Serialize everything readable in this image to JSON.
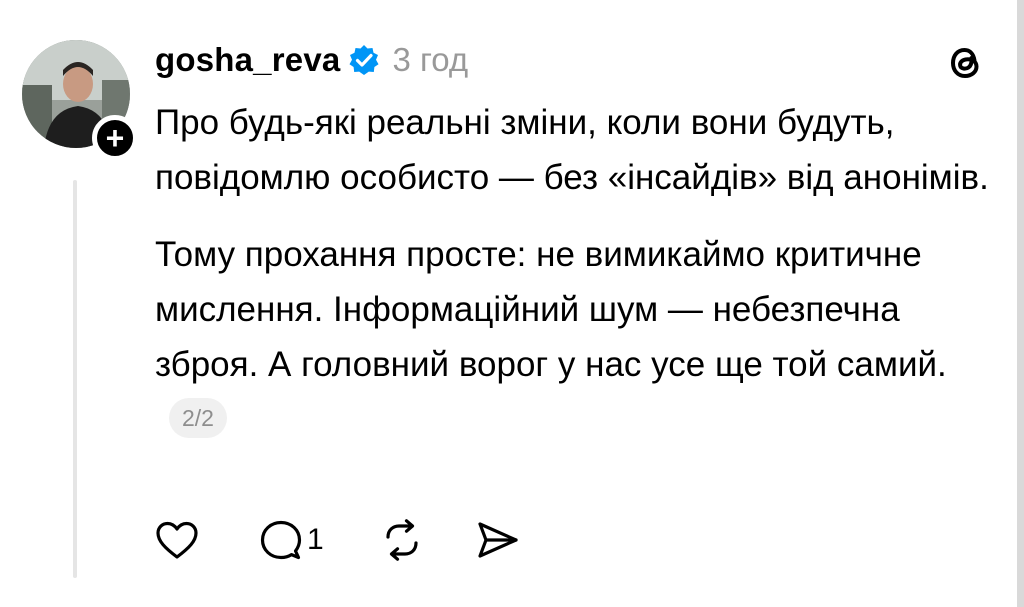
{
  "post": {
    "username": "gosha_reva",
    "time": "3 год",
    "paragraphs": [
      "Про будь-які реальні зміни, коли вони будуть, повідомлю особисто — без «інсайдів» від анонімів.",
      "Тому прохання просте: не вимикаймо критичне мислення. Інформаційний шум — небезпечна зброя. А головний ворог у нас усе ще той самий."
    ],
    "page_indicator": "2/2",
    "reply_count": "1"
  },
  "icons": {
    "verified": "verified-badge-icon",
    "threads": "threads-logo-icon",
    "follow": "plus-icon",
    "like": "heart-icon",
    "reply": "comment-icon",
    "repost": "repost-icon",
    "share": "send-icon"
  },
  "colors": {
    "verified": "#0095f6",
    "muted": "#999999",
    "thread_line": "#e5e5e5"
  }
}
